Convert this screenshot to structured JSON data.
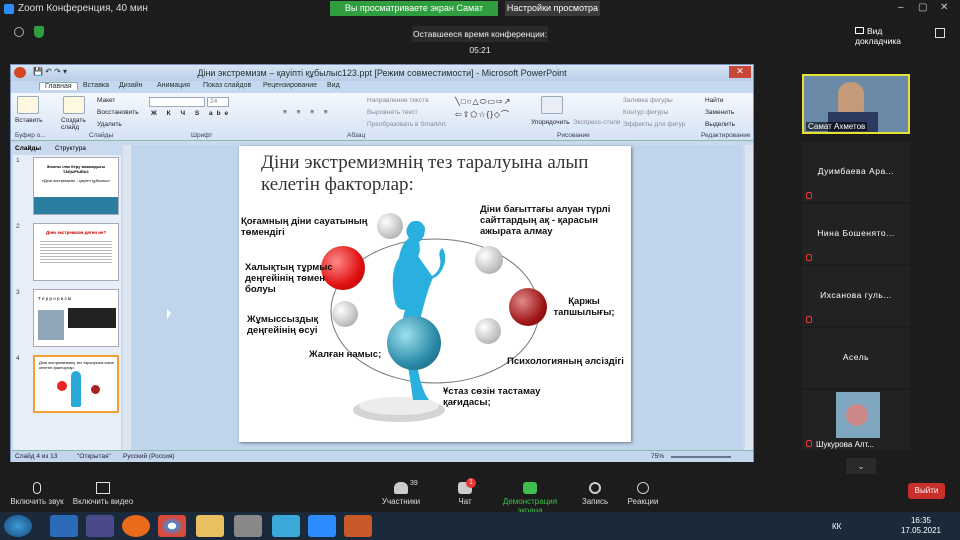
{
  "zoom": {
    "window_title": "Zoom Конференция, 40 мин",
    "share_banner": "Вы просматриваете экран Самат Ахметов",
    "view_settings": "Настройки просмотра ⌄",
    "timer": "Оставшееся время конференции: 05:21",
    "dual_monitor": "Вид докладчика",
    "minimize": "–",
    "maximize": "▢",
    "close": "✕"
  },
  "ppt": {
    "title": "Діни экстремизм – қауіпті құбылыс123.ppt [Режим совместимости] - Microsoft PowerPoint",
    "tabs": [
      "Главная",
      "Вставка",
      "Дизайн",
      "Анимация",
      "Показ слайдов",
      "Рецензирование",
      "Вид"
    ],
    "ribbon": {
      "paste": "Вставить",
      "create_slide": "Создать слайд",
      "layout": "Макет",
      "reset": "Восстановить",
      "delete": "Удалить",
      "font_size": "24",
      "text_dir": "Направление текста",
      "align_text": "Выровнять текст",
      "smartart": "Преобразовать в SmartArt",
      "arrange": "Упорядочить",
      "quick_styles": "Экспресс-стили",
      "fill": "Заливка фигуры",
      "outline": "Контур фигуры",
      "effects": "Эффекты для фигур",
      "find": "Найти",
      "replace": "Заменить",
      "select": "Выделить",
      "group_clipboard": "Буфер о...",
      "group_slides": "Слайды",
      "group_font": "Шрифт",
      "group_paragraph": "Абзац",
      "group_drawing": "Рисование",
      "group_editing": "Редактирование"
    },
    "panel_tabs": [
      "Слайды",
      "Структура"
    ],
    "thumbs": [
      {
        "num": "1",
        "title": "Жалпы ілім беру мамандығы ТАҚЫРЫБЫ:",
        "sub": "«Діни экстремизм – қауіпті құбылыс»"
      },
      {
        "num": "2",
        "title": "Діни экстремизм деген не?",
        "sub": ""
      },
      {
        "num": "3",
        "title": "Т е р р о р и з м",
        "sub": ""
      },
      {
        "num": "4",
        "title": "Діни экстремизмнің тез таралуына алып келетін факторлар:",
        "sub": ""
      }
    ],
    "slide": {
      "title": "Діни экстремизмнің тез таралуына алып келетін факторлар:",
      "factors": [
        "Қоғамның діни сауатының төмендігі",
        "Діни бағыттағы алуан түрлі сайттардың ақ - қарасын ажырата алмау",
        "Халықтың тұрмыс деңгейінің төмен болуы",
        "Қаржы тапшылығы;",
        "Жұмыссыздық деңгейінің өсуі",
        "Жалған намыс;",
        "Психологияның әлсіздігі",
        "Ұстаз сөзін тастамау қағидасы;"
      ]
    },
    "status": {
      "slide": "Слайд 4 из 13",
      "theme": "\"Открытая\"",
      "lang": "Русский (Россия)",
      "zoom": "75%"
    }
  },
  "participants": [
    {
      "name": "Самат Ахметов",
      "video": true,
      "muted": false
    },
    {
      "name": "Дуимбаева Ара...",
      "video": false,
      "muted": true
    },
    {
      "name": "Нина Бошенято...",
      "video": false,
      "muted": true
    },
    {
      "name": "Ихсанова гуль...",
      "video": false,
      "muted": true
    },
    {
      "name": "Асель",
      "video": false,
      "muted": false
    },
    {
      "name": "Шукурова Алт...",
      "video": true,
      "muted": true
    }
  ],
  "toolbar": {
    "mute": "Включить звук",
    "video": "Включить видео",
    "participants": "Участники",
    "participants_count": "39",
    "chat": "Чат",
    "chat_badge": "1",
    "share": "Демонстрация экрана",
    "record": "Запись",
    "reactions": "Реакции",
    "leave": "Выйти"
  },
  "taskbar": {
    "lang": "КК",
    "time": "16:35",
    "date": "17.05.2021"
  }
}
